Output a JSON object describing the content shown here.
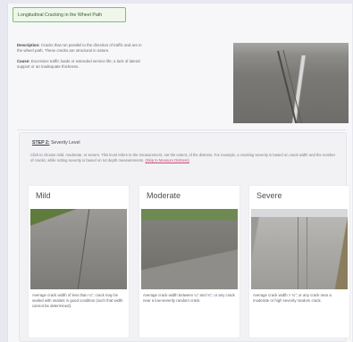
{
  "page": {
    "title": "Longitudinal Cracking in the Wheel Path"
  },
  "description": {
    "desc_label": "Description:",
    "desc_text": "Cracks that run parallel to the direction of traffic and are in the wheel path. These cracks are structural in nature.",
    "cause_label": "Cause:",
    "cause_text": "Excessive traffic loads or extended service life; a lack of lateral support or an inadequate thickness."
  },
  "step": {
    "heading_label": "STEP 2:",
    "heading_text": "Severity Level",
    "intro_text": "Click to choose mild, moderate, or severe. This level refers to the measurement, not the extent, of the distress. For example, a cracking severity is based on crack width and the number of cracks, while rutting severity is based on rut depth measurements.",
    "intro_link": "(Skip to Measure Distress)"
  },
  "levels": [
    {
      "title": "Mild",
      "caption": "Average crack width of less than ¼\"; crack may be sealed with sealant in good condition (such that width cannot be determined)."
    },
    {
      "title": "Moderate",
      "caption": "Average crack width between ¼\" and ¾\"; or any crack near a low-severity random crack."
    },
    {
      "title": "Severe",
      "caption": "Average crack width > ¾\"; or any crack near a moderate or high severity random crack."
    }
  ]
}
